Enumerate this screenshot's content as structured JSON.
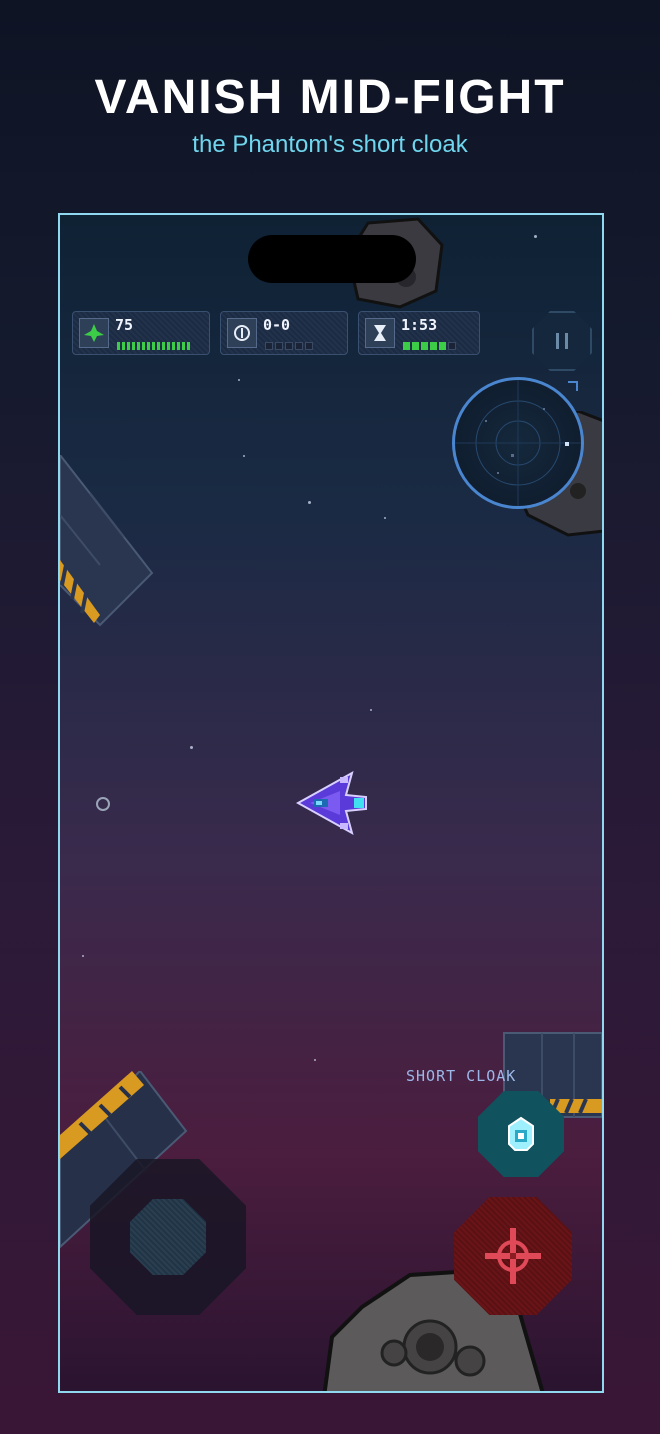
{
  "header": {
    "title": "VANISH MID-FIGHT",
    "subtitle": "the Phantom's short cloak"
  },
  "hud": {
    "hull": {
      "icon": "ship-health-icon",
      "value": "75",
      "color": "#3dcc48"
    },
    "score": {
      "icon": "shield-score-icon",
      "value": "0-0"
    },
    "timer": {
      "icon": "hourglass-icon",
      "value": "1:53",
      "color": "#3dcc48"
    },
    "pause_icon": "pause-icon"
  },
  "radar": {
    "icon": "radar-minimap"
  },
  "abilities": {
    "cloak_label": "SHORT CLOAK",
    "cloak_icon": "cloak-ghost-icon",
    "fire_icon": "crosshair-icon"
  },
  "colors": {
    "accent": "#8fd8f0",
    "subtitle": "#6fd6ee",
    "fire": "#6a1418",
    "cloak": "#10525e",
    "radar_ring": "#4a86d0"
  }
}
